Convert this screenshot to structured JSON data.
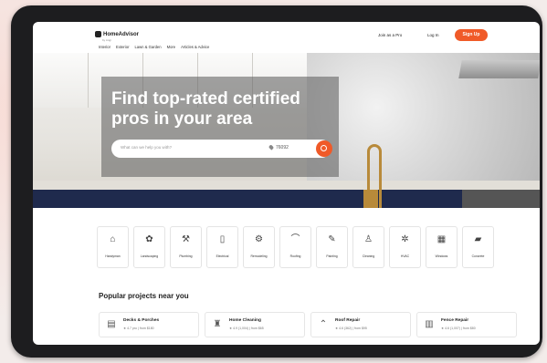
{
  "header": {
    "logo": "HomeAdvisor",
    "logo_sub": "by Angi",
    "join_link": "Join as a Pro",
    "login": "Log In",
    "signup": "Sign Up",
    "nav": [
      "Interior",
      "Exterior",
      "Lawn & Garden",
      "More",
      "Articles & Advice"
    ]
  },
  "hero": {
    "title": "Find top-rated certified pros in your area",
    "search_placeholder": "What can we help you with?",
    "zip": "76092"
  },
  "categories": [
    {
      "label": "Handyman",
      "icon": "toolbox-icon",
      "glyph": "⌂"
    },
    {
      "label": "Landscaping",
      "icon": "landscaping-icon",
      "glyph": "✿"
    },
    {
      "label": "Plumbing",
      "icon": "plumbing-icon",
      "glyph": "⚒"
    },
    {
      "label": "Electrical",
      "icon": "electrical-icon",
      "glyph": "▯"
    },
    {
      "label": "Remodeling",
      "icon": "remodeling-icon",
      "glyph": "⚙"
    },
    {
      "label": "Roofing",
      "icon": "roofing-icon",
      "glyph": "⌒"
    },
    {
      "label": "Painting",
      "icon": "painting-icon",
      "glyph": "✎"
    },
    {
      "label": "Cleaning",
      "icon": "cleaning-icon",
      "glyph": "♙"
    },
    {
      "label": "HVAC",
      "icon": "hvac-icon",
      "glyph": "✲"
    },
    {
      "label": "Windows",
      "icon": "windows-icon",
      "glyph": "▦"
    },
    {
      "label": "Concrete",
      "icon": "concrete-icon",
      "glyph": "▰"
    }
  ],
  "popular": {
    "title": "Popular projects near you",
    "cards": [
      {
        "name": "Decks & Porches",
        "meta": "★ 4.7 pro | from $180",
        "icon": "deck-icon",
        "glyph": "▤"
      },
      {
        "name": "Home Cleaning",
        "meta": "★ 4.9 (1,004) | from $65",
        "icon": "cleaning-spray-icon",
        "glyph": "♜"
      },
      {
        "name": "Roof Repair",
        "meta": "★ 4.6 (362) | from $95",
        "icon": "roof-icon",
        "glyph": "⌃"
      },
      {
        "name": "Fence Repair",
        "meta": "★ 4.6 (1,007) | from $80",
        "icon": "fence-icon",
        "glyph": "▥"
      }
    ]
  },
  "colors": {
    "accent": "#f05a28",
    "bezel": "#1d1d1f",
    "navy": "#1f2a4d"
  }
}
